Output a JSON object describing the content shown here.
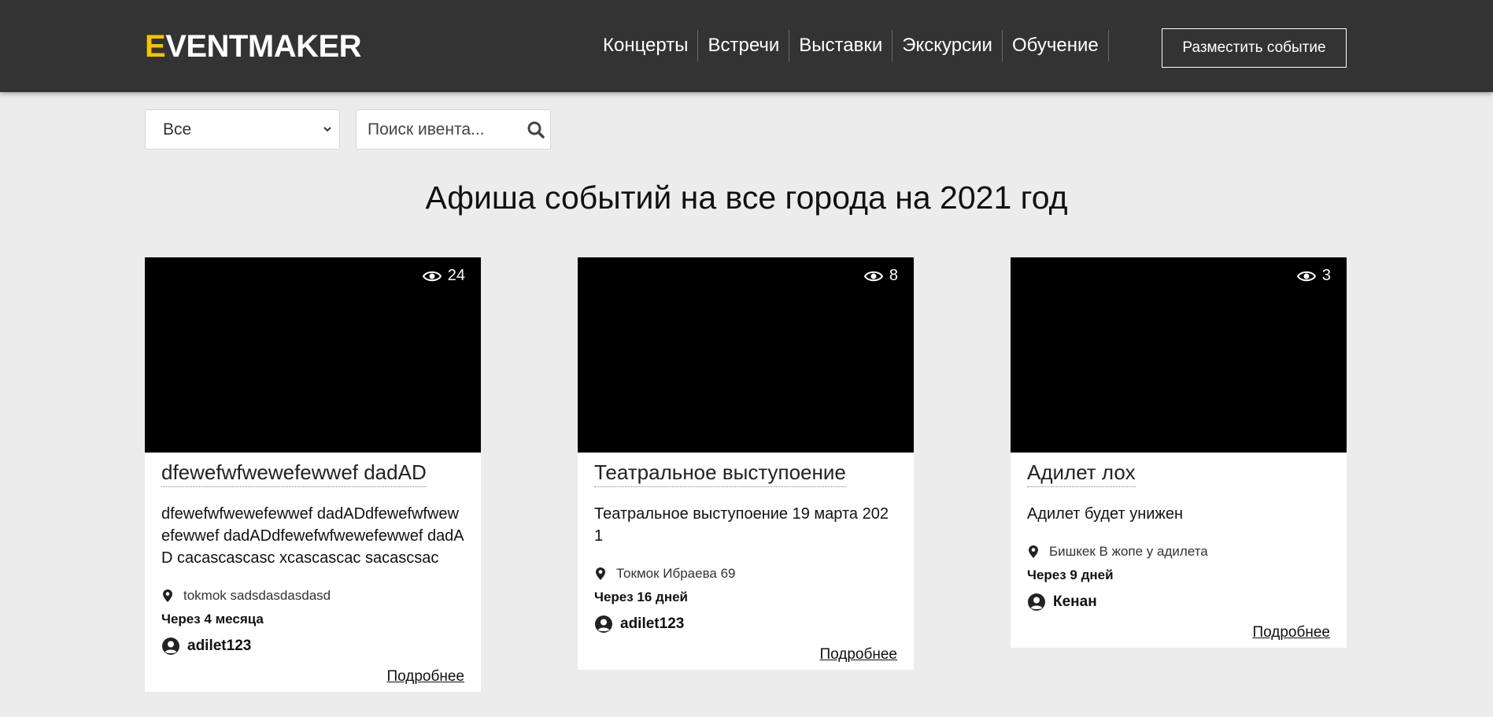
{
  "header": {
    "logo_first": "E",
    "logo_rest": "VENTMAKER",
    "nav": [
      "Концерты",
      "Встречи",
      "Выставки",
      "Экскурсии",
      "Обучение"
    ],
    "post_button": "Разместить событие"
  },
  "filters": {
    "category_selected": "Все",
    "search_placeholder": "Поиск ивента..."
  },
  "page_title": "Афиша событий на все города на 2021 год",
  "cards": [
    {
      "views": "24",
      "title": "dfewefwfwewefewwef dadAD",
      "description": "dfewefwfwewefewwef dadADdfewefwfwewefewwef dadADdfewefwfwewefewwef dadAD cacascascasc xcascascac sacascsac",
      "location": "tokmok sadsdasdasdasd",
      "when": "Через 4 месяца",
      "author": "adilet123",
      "more": "Подробнее"
    },
    {
      "views": "8",
      "title": "Театральное выступоение",
      "description": "Театральное выступоение 19 марта 2021",
      "location": "Токмок Ибраева 69",
      "when": "Через 16 дней",
      "author": "adilet123",
      "more": "Подробнее"
    },
    {
      "views": "3",
      "title": "Адилет лох",
      "description": "Адилет будет унижен",
      "location": "Бишкек В жопе у адилета",
      "when": "Через 9 дней",
      "author": "Кенан",
      "more": "Подробнее"
    }
  ],
  "colors": {
    "header_bg": "#333333",
    "logo_accent": "#f5c400",
    "page_bg": "#ececec",
    "card_image": "#000000"
  }
}
